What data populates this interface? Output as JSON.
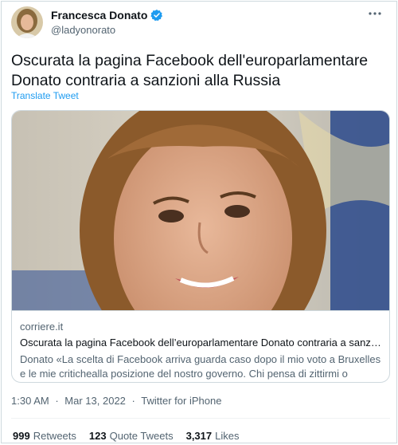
{
  "user": {
    "name": "Francesca Donato",
    "handle": "@ladyonorato"
  },
  "more_icon": "more-options-icon",
  "tweet": {
    "text": "Oscurata la pagina Facebook dell'europarlamentare Donato contraria a sanzioni alla Russia",
    "translate": "Translate Tweet"
  },
  "card": {
    "domain": "corriere.it",
    "title": "Oscurata la pagina Facebook dell’europarlamentare Donato contraria a sanzioni alla Russia",
    "description": "Donato «La scelta di Facebook arriva guarda caso dopo il mio voto a Bruxelles e le mie critichealla posizione del nostro governo. Chi pensa di zittirmi o intimorirmi si sbaglia»"
  },
  "meta": {
    "time": "1:30 AM",
    "separator": "·",
    "date": "Mar 13, 2022",
    "source": "Twitter for iPhone"
  },
  "stats": {
    "retweets_count": "999",
    "retweets_label": "Retweets",
    "quotes_count": "123",
    "quotes_label": "Quote Tweets",
    "likes_count": "3,317",
    "likes_label": "Likes"
  },
  "colors": {
    "accent": "#1d9bf0",
    "secondary_text": "#536471",
    "border": "#cfd9de"
  }
}
